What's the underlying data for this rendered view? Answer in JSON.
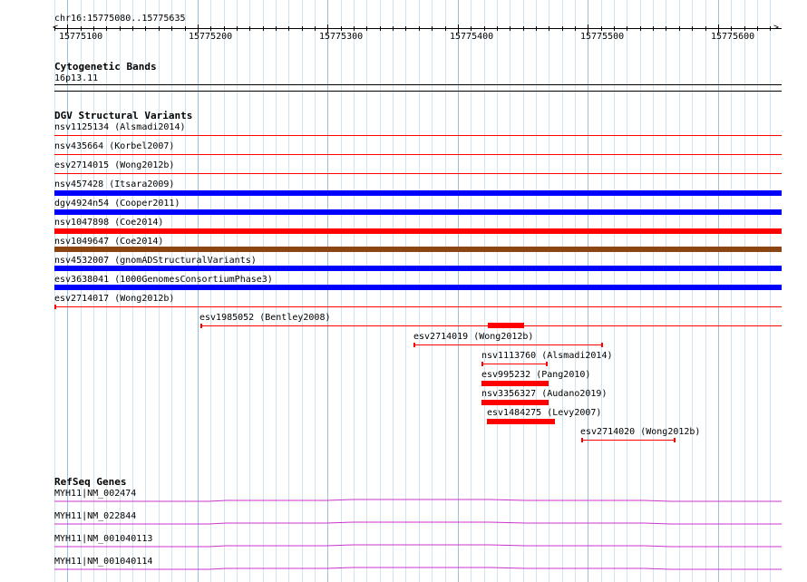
{
  "ruler": {
    "location": "chr16:15775080..15775635",
    "tick_labels": [
      "15775100",
      "15775200",
      "15775300",
      "15775400",
      "15775500",
      "15775600"
    ]
  },
  "cytoband": {
    "title": "Cytogenetic Bands",
    "band": "16p13.11"
  },
  "dgv": {
    "title": "DGV Structural Variants",
    "colors": {
      "red": "#ff0000",
      "blue": "#0000ff",
      "brown": "#8b4513"
    },
    "features": [
      "nsv1125134 (Alsmadi2014)",
      "nsv435664 (Korbel2007)",
      "esv2714015 (Wong2012b)",
      "nsv457428 (Itsara2009)",
      "dgv4924n54 (Cooper2011)",
      "nsv1047898 (Coe2014)",
      "nsv1049647 (Coe2014)",
      "nsv4532007 (gnomADStructuralVariants)",
      "esv3638041 (1000GenomesConsortiumPhase3)",
      "esv2714017 (Wong2012b)",
      "esv1985052 (Bentley2008)",
      "esv2714019 (Wong2012b)",
      "nsv1113760 (Alsmadi2014)",
      "esv995232 (Pang2010)",
      "nsv3356327 (Audano2019)",
      "esv1484275 (Levy2007)",
      "esv2714020 (Wong2012b)"
    ]
  },
  "refseq": {
    "title": "RefSeq Genes",
    "color": "#cc33cc",
    "genes": [
      "MYH11|NM_002474",
      "MYH11|NM_022844",
      "MYH11|NM_001040113",
      "MYH11|NM_001040114"
    ]
  }
}
